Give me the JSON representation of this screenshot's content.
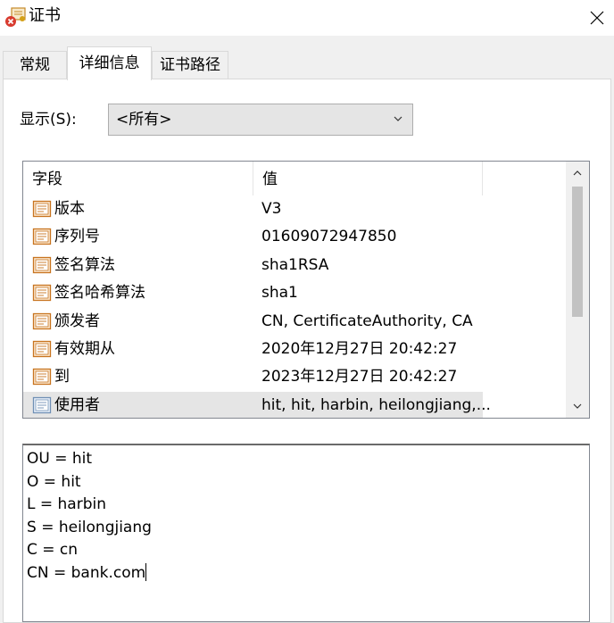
{
  "window": {
    "title": "证书",
    "close_icon": "close-icon"
  },
  "tabs": [
    {
      "label": "常规",
      "active": false
    },
    {
      "label": "详细信息",
      "active": true
    },
    {
      "label": "证书路径",
      "active": false
    }
  ],
  "show": {
    "label": "显示(S):",
    "selected": "<所有>"
  },
  "fields_table": {
    "columns": [
      "字段",
      "值"
    ],
    "rows": [
      {
        "field": "版本",
        "value": "V3",
        "icon": "certificate-field-icon",
        "selected": false
      },
      {
        "field": "序列号",
        "value": "01609072947850",
        "icon": "certificate-field-icon",
        "selected": false
      },
      {
        "field": "签名算法",
        "value": "sha1RSA",
        "icon": "certificate-field-icon",
        "selected": false
      },
      {
        "field": "签名哈希算法",
        "value": "sha1",
        "icon": "certificate-field-icon",
        "selected": false
      },
      {
        "field": "颁发者",
        "value": "CN, CertificateAuthority, CA",
        "icon": "certificate-field-icon",
        "selected": false
      },
      {
        "field": "有效期从",
        "value": "2020年12月27日 20:42:27",
        "icon": "certificate-field-icon",
        "selected": false
      },
      {
        "field": "到",
        "value": "2023年12月27日 20:42:27",
        "icon": "certificate-field-icon",
        "selected": false
      },
      {
        "field": "使用者",
        "value": "hit, hit, harbin, heilongjiang,...",
        "icon": "certificate-field-icon",
        "selected": true
      }
    ]
  },
  "detail": {
    "lines": [
      "OU = hit",
      "O = hit",
      "L = harbin",
      "S = heilongjiang",
      "C = cn",
      "CN = bank.com"
    ]
  },
  "colors": {
    "selection": "#e5e5e5",
    "window_bg": "#f0f0f0",
    "icon_orange": "#d67a1e"
  }
}
